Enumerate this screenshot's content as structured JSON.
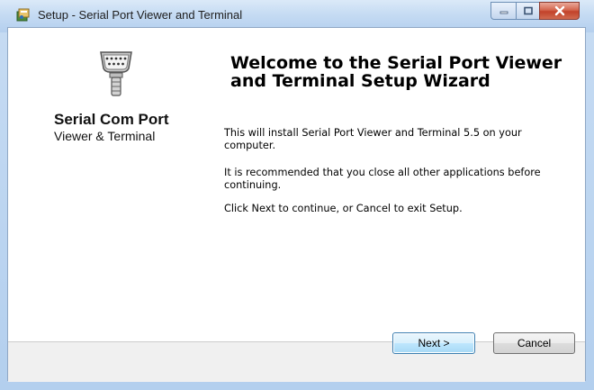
{
  "window": {
    "title": "Setup - Serial Port Viewer and Terminal"
  },
  "sidebar": {
    "product_name": "Serial Com Port",
    "product_subtitle": "Viewer & Terminal"
  },
  "main": {
    "heading": "Welcome to the Serial Port Viewer and Terminal Setup Wizard",
    "paragraph1": "This will install Serial Port Viewer and Terminal 5.5 on your computer.",
    "paragraph2": "It is recommended that you close all other applications before continuing.",
    "paragraph3": "Click Next to continue, or Cancel to exit Setup."
  },
  "buttons": {
    "next_label": "Next >",
    "cancel_label": "Cancel"
  },
  "icons": {
    "title": "setup-installer-icon",
    "graphic": "serial-port-connector-icon"
  },
  "colors": {
    "close_button": "#c2422a",
    "title_bar": "#c5dbf3",
    "next_button_border": "#3c7fb1"
  }
}
